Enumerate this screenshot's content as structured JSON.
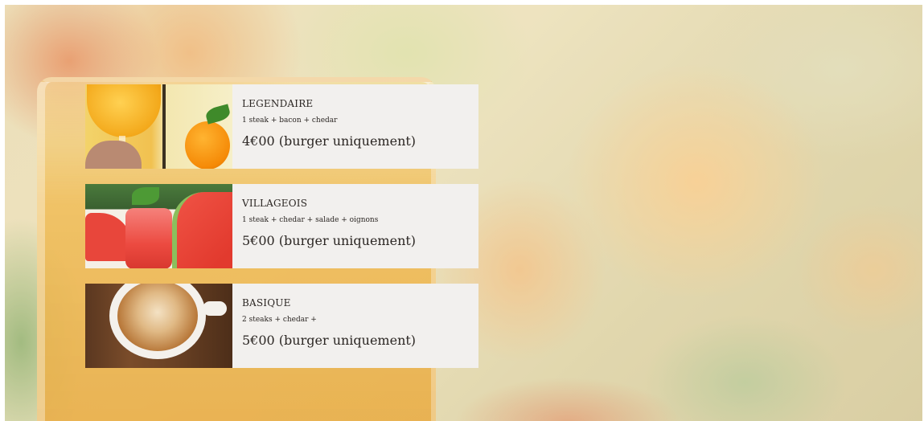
{
  "colors": {
    "card_background": "#f2f0ee",
    "text": "#2b2623"
  },
  "menu": {
    "items": [
      {
        "name": "LEGENDAIRE",
        "description": "1 steak + bacon + chedar",
        "price": "4€00 (burger uniquement)",
        "image": "orange-juice-photo"
      },
      {
        "name": "VILLAGEOIS",
        "description": "1 steak + chedar + salade + oignons",
        "price": "5€00 (burger uniquement)",
        "image": "watermelon-juice-photo"
      },
      {
        "name": "BASIQUE",
        "description": "2 steaks + chedar +",
        "price": "5€00 (burger uniquement)",
        "image": "latte-art-coffee-photo"
      }
    ]
  }
}
